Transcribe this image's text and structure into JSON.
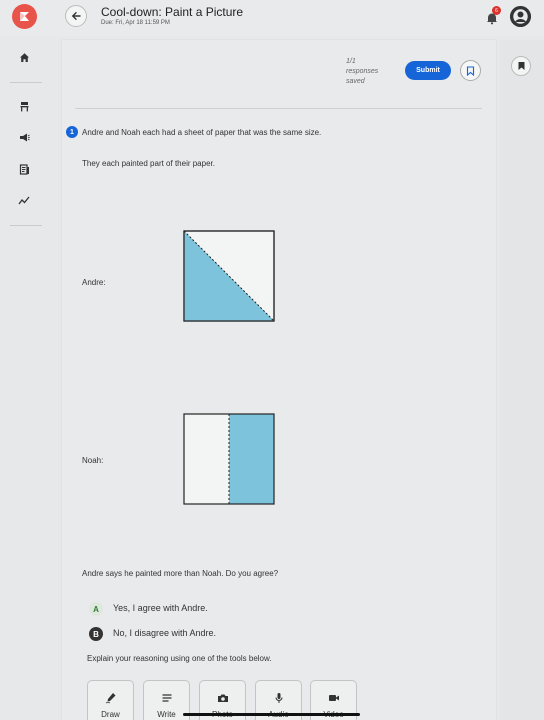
{
  "header": {
    "title": "Cool-down: Paint a Picture",
    "due": "Due: Fri, Apr 18 11:59 PM",
    "notification_count": "6"
  },
  "status": {
    "saved_line1": "1/1",
    "saved_line2": "responses",
    "saved_line3": "saved",
    "submit_label": "Submit"
  },
  "question": {
    "number": "1",
    "prompt": "Andre and Noah each had a sheet of paper that was the same size.",
    "sub": "They each painted part of their paper.",
    "andre_label": "Andre:",
    "noah_label": "Noah:",
    "ask": "Andre says he painted more than Noah. Do you agree?",
    "options": [
      {
        "letter": "A",
        "text": "Yes, I agree with Andre."
      },
      {
        "letter": "B",
        "text": "No, I disagree with Andre."
      }
    ],
    "explain": "Explain your reasoning using one of the tools below."
  },
  "tools": [
    {
      "label": "Draw",
      "icon": "draw-icon"
    },
    {
      "label": "Write",
      "icon": "write-icon"
    },
    {
      "label": "Photo",
      "icon": "camera-icon"
    },
    {
      "label": "Audio",
      "icon": "microphone-icon"
    },
    {
      "label": "Video",
      "icon": "video-icon"
    }
  ],
  "colors": {
    "accent": "#1565d8",
    "paint": "#7dc3dc",
    "logo": "#e8534a"
  }
}
